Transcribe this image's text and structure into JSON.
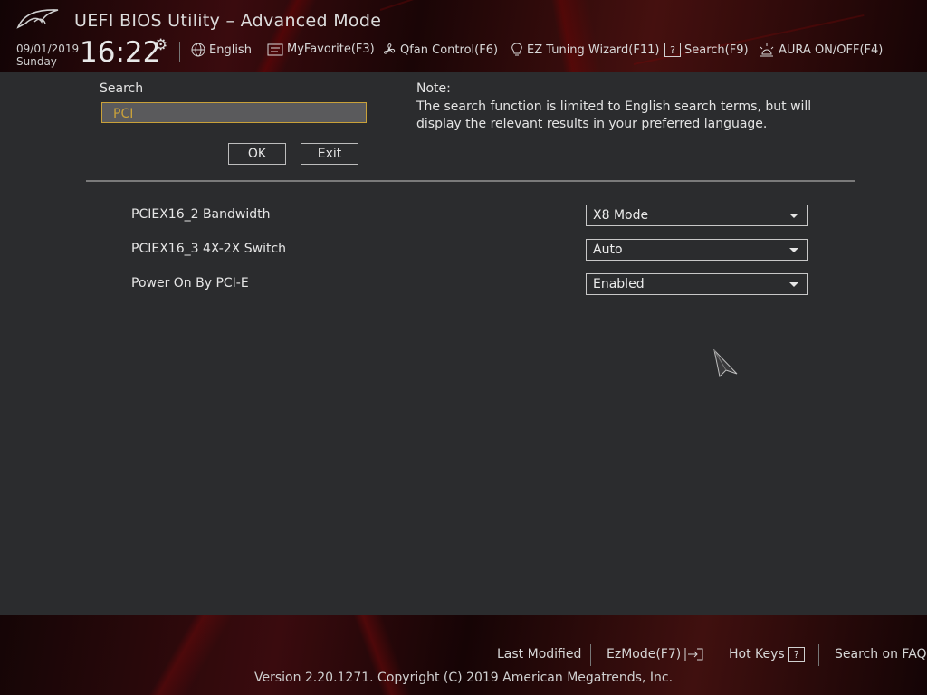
{
  "app": {
    "title": "UEFI BIOS Utility – Advanced Mode",
    "date": "09/01/2019",
    "day": "Sunday",
    "time": "16:22"
  },
  "toolbar": {
    "language": "English",
    "myfavorite": "MyFavorite(F3)",
    "qfan": "Qfan Control(F6)",
    "ez_tuning": "EZ Tuning Wizard(F11)",
    "search": "Search(F9)",
    "aura": "AURA ON/OFF(F4)"
  },
  "search": {
    "label": "Search",
    "value": "PCI",
    "ok_label": "OK",
    "exit_label": "Exit"
  },
  "note": {
    "title": "Note:",
    "text": "The search function is limited to English search terms, but will display the relevant results in your preferred language."
  },
  "results": [
    {
      "label": "PCIEX16_2 Bandwidth",
      "value": "X8 Mode"
    },
    {
      "label": "PCIEX16_3 4X-2X Switch",
      "value": "Auto"
    },
    {
      "label": "Power On By PCI-E",
      "value": "Enabled"
    }
  ],
  "footer": {
    "last_modified": "Last Modified",
    "ezmode": "EzMode(F7)",
    "hot_keys": "Hot Keys",
    "hot_keys_key": "?",
    "search_faq": "Search on FAQ",
    "copyright": "Version 2.20.1271. Copyright (C) 2019 American Megatrends, Inc."
  },
  "colors": {
    "accent": "#c9a13a",
    "background": "#2b2c2e",
    "header_red": "#3a0b0e"
  }
}
